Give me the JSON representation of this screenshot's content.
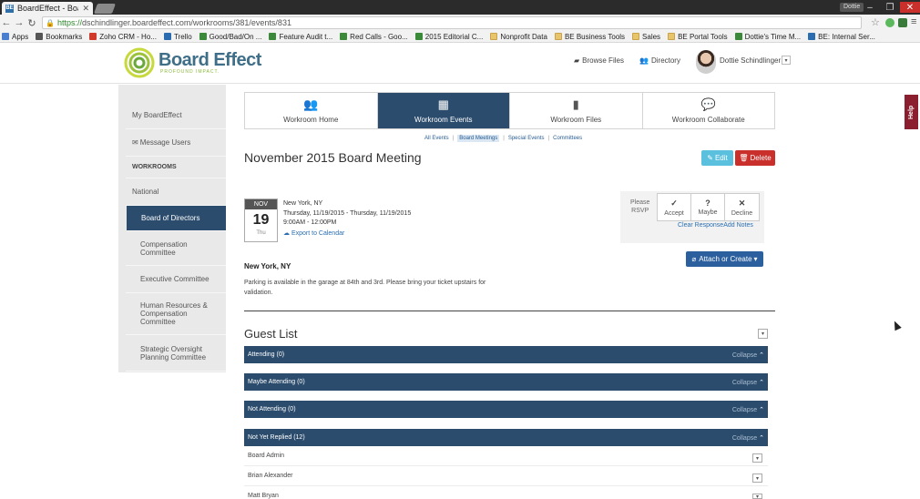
{
  "browser": {
    "tab_title": "BoardEffect - Boardi",
    "tab_favicon": "BE",
    "url_secure": "https://",
    "url_rest": "dschindlinger.boardeffect.com/workrooms/381/events/831",
    "user_badge": "Dottie",
    "bookmarks": [
      {
        "label": "Apps",
        "icon": "apps-icon",
        "color": "#4a7fd0"
      },
      {
        "label": "Bookmarks",
        "icon": "star-icon",
        "color": "#555555"
      },
      {
        "label": "Zoho CRM - Ho...",
        "icon": "zoho-icon",
        "color": "#d03a2b"
      },
      {
        "label": "Trello",
        "icon": "trello-icon",
        "color": "#2b6cb0"
      },
      {
        "label": "Good/Bad/On ...",
        "icon": "doc-icon",
        "color": "#3a8a3a"
      },
      {
        "label": "Feature Audit t...",
        "icon": "sheet-icon",
        "color": "#3a8a3a"
      },
      {
        "label": "Red Calls - Goo...",
        "icon": "sheet-icon",
        "color": "#3a8a3a"
      },
      {
        "label": "2015 Editorial C...",
        "icon": "sheet-icon",
        "color": "#3a8a3a"
      },
      {
        "label": "Nonprofit Data",
        "icon": "folder-icon",
        "color": "#e8c46a"
      },
      {
        "label": "BE Business Tools",
        "icon": "folder-icon",
        "color": "#e8c46a"
      },
      {
        "label": "Sales",
        "icon": "folder-icon",
        "color": "#e8c46a"
      },
      {
        "label": "BE Portal Tools",
        "icon": "folder-icon",
        "color": "#e8c46a"
      },
      {
        "label": "Dottie's Time M...",
        "icon": "sheet-icon",
        "color": "#3a8a3a"
      },
      {
        "label": "BE: Internal Ser...",
        "icon": "globe-icon",
        "color": "#2a6eb0"
      }
    ]
  },
  "header": {
    "logo_name": "Board Effect",
    "logo_tagline": "PROFOUND IMPACT.",
    "browse_files": "Browse Files",
    "directory": "Directory",
    "user_name": "Dottie Schindlinger"
  },
  "sidebar": {
    "items": [
      {
        "label": "My BoardEffect"
      },
      {
        "label": "Message Users"
      },
      {
        "label": "WORKROOMS"
      },
      {
        "label": "National"
      },
      {
        "label": "Board of Directors"
      },
      {
        "label": "Compensation Committee"
      },
      {
        "label": "Executive Committee"
      },
      {
        "label": "Human Resources & Compensation Committee"
      },
      {
        "label": "Strategic Oversight Planning Committee"
      }
    ]
  },
  "workroom_tabs": [
    {
      "label": "Workroom Home",
      "icon": "users-icon"
    },
    {
      "label": "Workroom Events",
      "icon": "calendar-icon"
    },
    {
      "label": "Workroom Files",
      "icon": "file-icon"
    },
    {
      "label": "Workroom Collaborate",
      "icon": "chat-icon"
    }
  ],
  "subnav": [
    "All Events",
    "Board Meetings",
    "Special Events",
    "Committees"
  ],
  "event": {
    "title": "November 2015 Board Meeting",
    "edit_label": "Edit",
    "delete_label": "Delete",
    "cal_month": "NOV",
    "cal_day": "19",
    "cal_dow": "Thu",
    "location": "New York, NY",
    "dates": "Thursday, 11/19/2015 - Thursday, 11/19/2015",
    "time": "9:00AM - 12:00PM",
    "export": "Export to Calendar",
    "location_heading": "New York, NY",
    "note": "Parking is available in the garage at 84th and 3rd.  Please bring your ticket upstairs for validation."
  },
  "rsvp": {
    "label_line1": "Please",
    "label_line2": "RSVP",
    "accept": "Accept",
    "maybe": "Maybe",
    "decline": "Decline",
    "clear": "Clear Response",
    "add_notes": "Add Notes"
  },
  "attach_label": "Attach or Create",
  "guest_list": {
    "title": "Guest List",
    "collapse_label": "Collapse",
    "groups": [
      {
        "label": "Attending (0)"
      },
      {
        "label": "Maybe Attending (0)"
      },
      {
        "label": "Not Attending (0)"
      },
      {
        "label": "Not Yet Replied (12)"
      }
    ],
    "guests": [
      "Board Admin",
      "Brian Alexander",
      "Matt Bryan"
    ]
  },
  "help_label": "Help"
}
